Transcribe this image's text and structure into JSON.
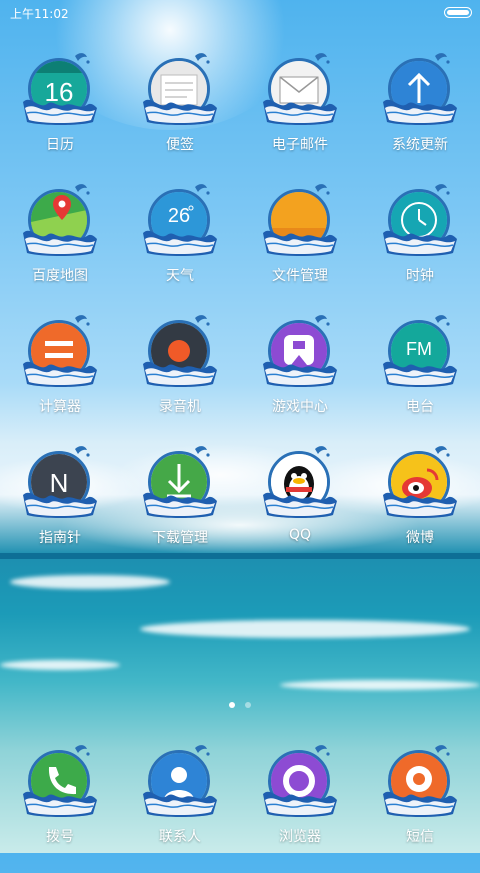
{
  "status_bar": {
    "time": "上午11:02",
    "battery_level": 1.0
  },
  "apps": [
    [
      {
        "label": "日历",
        "icon": "calendar-icon",
        "text": "16",
        "color": "#17a89a"
      },
      {
        "label": "便签",
        "icon": "notes-icon",
        "text": "",
        "color": "#e9e9e9"
      },
      {
        "label": "电子邮件",
        "icon": "mail-icon",
        "text": "",
        "color": "#f2f2f2"
      },
      {
        "label": "系统更新",
        "icon": "update-arrow-icon",
        "text": "",
        "color": "#2e84d6"
      }
    ],
    [
      {
        "label": "百度地图",
        "icon": "map-pin-icon",
        "text": "",
        "color": "#3daa4a"
      },
      {
        "label": "天气",
        "icon": "weather-icon",
        "text": "26",
        "color": "#2d97d8"
      },
      {
        "label": "文件管理",
        "icon": "folder-icon",
        "text": "",
        "color": "#f3a21f"
      },
      {
        "label": "时钟",
        "icon": "clock-icon",
        "text": "",
        "color": "#16a6b3"
      }
    ],
    [
      {
        "label": "计算器",
        "icon": "calculator-icon",
        "text": "",
        "color": "#ef6a2a"
      },
      {
        "label": "录音机",
        "icon": "recorder-icon",
        "text": "",
        "color": "#333a44"
      },
      {
        "label": "游戏中心",
        "icon": "gamepad-icon",
        "text": "",
        "color": "#8d4bd3"
      },
      {
        "label": "电台",
        "icon": "radio-icon",
        "text": "FM",
        "color": "#14a89b"
      }
    ],
    [
      {
        "label": "指南针",
        "icon": "compass-icon",
        "text": "N",
        "color": "#3c4450"
      },
      {
        "label": "下载管理",
        "icon": "download-icon",
        "text": "",
        "color": "#45a848"
      },
      {
        "label": "QQ",
        "icon": "qq-penguin-icon",
        "text": "",
        "color": "#ffffff"
      },
      {
        "label": "微博",
        "icon": "weibo-icon",
        "text": "",
        "color": "#f6c21a"
      }
    ]
  ],
  "pager": {
    "pages": 2,
    "current": 1
  },
  "dock": [
    {
      "label": "拨号",
      "icon": "phone-icon",
      "text": "",
      "color": "#3daa4a"
    },
    {
      "label": "联系人",
      "icon": "contacts-icon",
      "text": "",
      "color": "#2e84d6"
    },
    {
      "label": "浏览器",
      "icon": "browser-icon",
      "text": "",
      "color": "#8d4bd3"
    },
    {
      "label": "短信",
      "icon": "message-icon",
      "text": "",
      "color": "#ef6a2a"
    }
  ]
}
